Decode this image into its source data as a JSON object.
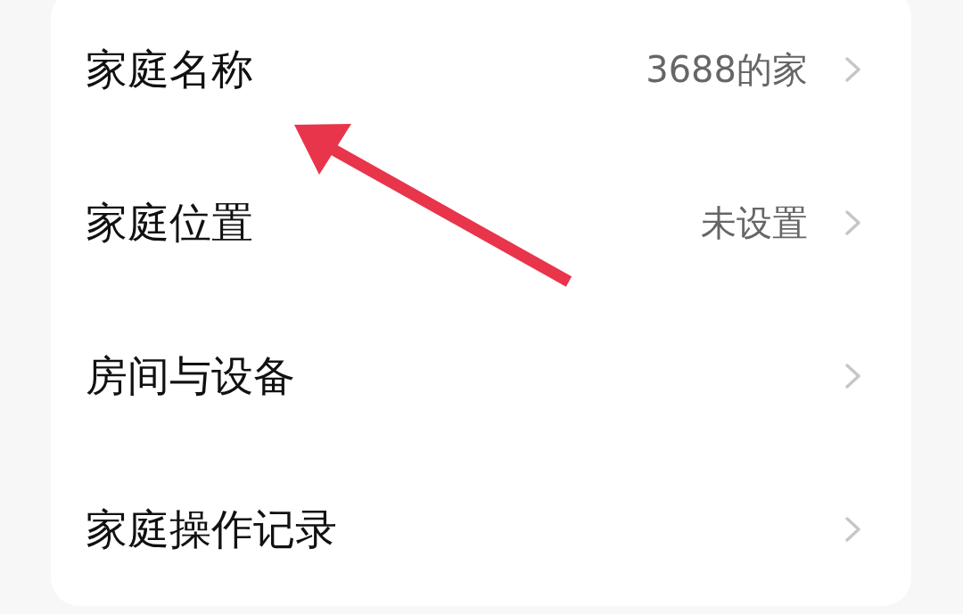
{
  "rows": [
    {
      "label": "家庭名称",
      "value": "3688的家"
    },
    {
      "label": "家庭位置",
      "value": "未设置"
    },
    {
      "label": "房间与设备"
    },
    {
      "label": "家庭操作记录"
    }
  ]
}
